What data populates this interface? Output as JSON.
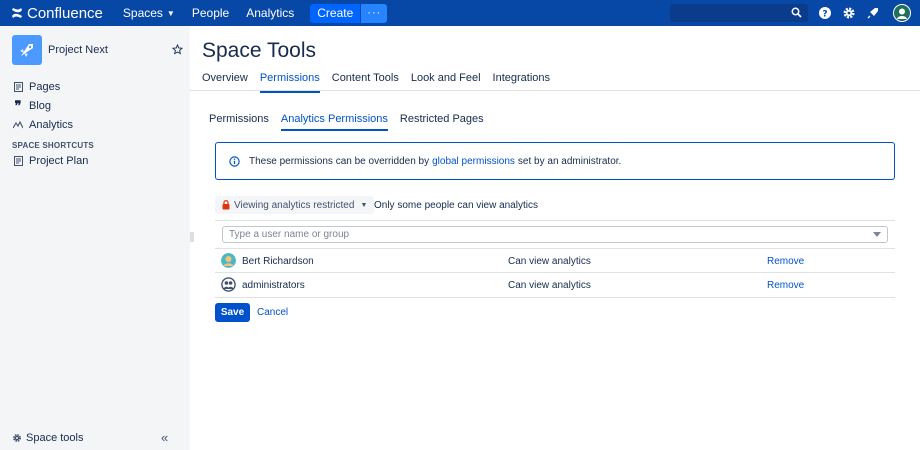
{
  "topnav": {
    "brand": "Confluence",
    "spaces": "Spaces",
    "people": "People",
    "analytics": "Analytics",
    "create": "Create",
    "more": "···"
  },
  "sidebar": {
    "space_name": "Project Next",
    "links": [
      {
        "label": "Pages",
        "icon": "pages-icon"
      },
      {
        "label": "Blog",
        "icon": "quote-icon"
      },
      {
        "label": "Analytics",
        "icon": "analytics-icon"
      }
    ],
    "section_title": "SPACE SHORTCUTS",
    "shortcuts": [
      {
        "label": "Project Plan",
        "icon": "page-icon"
      }
    ],
    "space_tools": "Space tools",
    "collapse": "«"
  },
  "main": {
    "title": "Space Tools",
    "tabs": [
      {
        "label": "Overview",
        "active": false
      },
      {
        "label": "Permissions",
        "active": true
      },
      {
        "label": "Content Tools",
        "active": false
      },
      {
        "label": "Look and Feel",
        "active": false
      },
      {
        "label": "Integrations",
        "active": false
      }
    ],
    "subtabs": [
      {
        "label": "Permissions",
        "active": false
      },
      {
        "label": "Analytics Permissions",
        "active": true
      },
      {
        "label": "Restricted Pages",
        "active": false
      }
    ],
    "info": {
      "text_before": "These permissions can be overridden by",
      "link": "global permissions",
      "text_after": "set by an administrator."
    },
    "restriction": {
      "button_label": "Viewing analytics restricted",
      "description": "Only some people can view analytics"
    },
    "user_input_placeholder": "Type a user name or group",
    "rows": [
      {
        "name": "Bert Richardson",
        "permission": "Can view analytics",
        "action": "Remove"
      },
      {
        "name": "administrators",
        "permission": "Can view analytics",
        "action": "Remove"
      }
    ],
    "save": "Save",
    "cancel": "Cancel"
  },
  "colors": {
    "nav_bg": "#0747A6",
    "accent": "#0052CC",
    "create_btn": "#0065FF",
    "sidebar_bg": "#F4F5F7",
    "lock": "#DE350B"
  }
}
